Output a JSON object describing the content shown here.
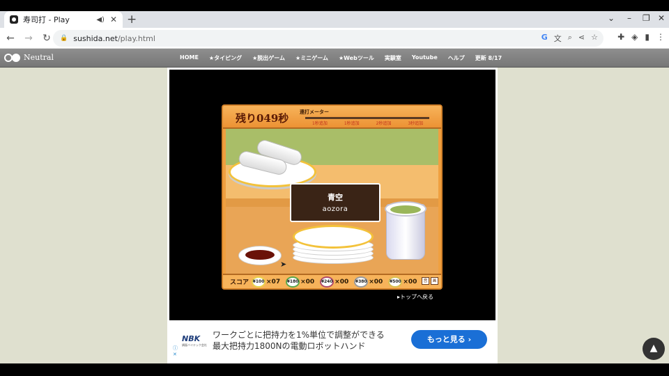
{
  "browser": {
    "tab_title": "寿司打 - Play",
    "url_host": "sushida.net",
    "url_path": "/play.html",
    "new_tab": "+",
    "audio_icon": "speaker-icon",
    "close_glyph": "✕"
  },
  "site_nav": {
    "logo_text": "Neutral",
    "items": [
      "HOME",
      "★タイピング",
      "★脱出ゲーム",
      "★ミニゲーム",
      "★Webツール",
      "実験室",
      "Youtube",
      "ヘルプ",
      "更新 8/17"
    ]
  },
  "game": {
    "timer_text": "残り049秒",
    "meter_label": "連打メーター",
    "meter_ticks": [
      "1秒追加",
      "1秒追加",
      "2秒追加",
      "3秒追加"
    ],
    "prompt_japanese": "青空",
    "prompt_romaji": "aozora",
    "score_label": "スコア",
    "plates": [
      {
        "price": "¥100",
        "count": "×07",
        "color": "#e8d24a"
      },
      {
        "price": "¥180",
        "count": "×00",
        "color": "#5aa64a"
      },
      {
        "price": "¥240",
        "count": "×00",
        "color": "#b04a6a"
      },
      {
        "price": "¥380",
        "count": "×00",
        "color": "#9a9a9a"
      },
      {
        "price": "¥500",
        "count": "×00",
        "color": "#d8c050"
      }
    ],
    "corner_icons": [
      "音",
      "画"
    ],
    "back_to_top": "▸トップへ戻る"
  },
  "ad": {
    "brand": "NBK",
    "brand_sub": "鍋屋バイテック会社",
    "line1": "ワークごとに把持力を1%単位で調整ができる",
    "line2": "最大把持力1800Nの電動ロボットハンド",
    "cta": "もっと見る ›"
  },
  "page_top_button": "▲"
}
